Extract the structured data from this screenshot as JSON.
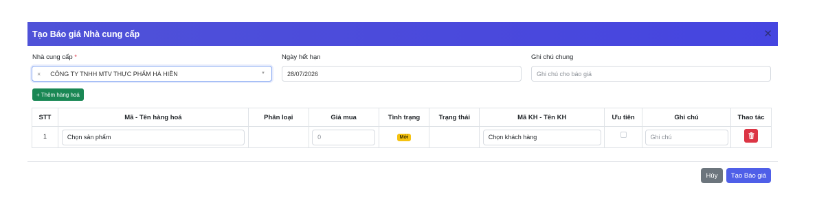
{
  "modal": {
    "title": "Tạo Báo giá Nhà cung cấp"
  },
  "form": {
    "supplier_label": "Nhà cung cấp",
    "required_mark": "*",
    "supplier_value": "CÔNG TY TNHH MTV THỰC PHẨM HÀ HIỀN",
    "clear_glyph": "×",
    "expiry_label": "Ngày hết hạn",
    "expiry_value": "28/07/2026",
    "note_label": "Ghi chú chung",
    "note_placeholder": "Ghi chú cho báo giá"
  },
  "add_item_button": {
    "label": "+ Thêm hàng hoá"
  },
  "table": {
    "headers": [
      "STT",
      "Mã - Tên hàng hoá",
      "Phân loại",
      "Giá mua",
      "Tình trạng",
      "Trạng thái",
      "Mã KH - Tên KH",
      "Ưu tiên",
      "Ghi chú",
      "Thao tác"
    ],
    "rows": [
      {
        "stt": "1",
        "product": "Chọn sản phẩm",
        "category": "",
        "price": "0",
        "condition": "Mới",
        "status": "",
        "customer": "Chọn khách hàng",
        "priority_checked": false,
        "note_placeholder": "Ghi chú"
      }
    ]
  },
  "footer": {
    "cancel_label": "Hủy",
    "create_label": "Tạo Báo giá"
  },
  "colors": {
    "header": "#4a49dc",
    "add": "#198754",
    "badge": "#f5c211",
    "delete": "#dc3545",
    "cancel": "#6c757d",
    "create": "#4f5fe8"
  },
  "icons": {
    "close": "close-icon",
    "delete": "trash-icon",
    "caret": "chevron-down-icon"
  }
}
